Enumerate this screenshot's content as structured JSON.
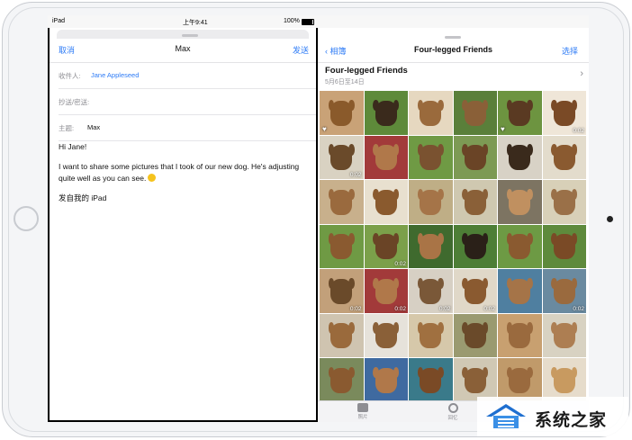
{
  "status_bar": {
    "device": "iPad",
    "time": "上午9:41",
    "battery": "100%"
  },
  "mail": {
    "cancel": "取消",
    "title": "Max",
    "send": "发送",
    "to_label": "收件人:",
    "to_value": "Jane Appleseed",
    "cc_label": "抄送/密送:",
    "subject_label": "主题:",
    "subject_value": "Max",
    "greeting": "Hi Jane!",
    "body": "I want to share some pictures that I took of our new dog. He's adjusting quite well as you can see.",
    "signature": "发自我的 iPad"
  },
  "photos": {
    "back_label": "相簿",
    "nav_title": "Four-legged Friends",
    "select_label": "选择",
    "album_title": "Four-legged Friends",
    "album_date": "5月6日至14日",
    "thumbnails": [
      {
        "bg": "#c9a277",
        "dog": "#8a5a2b"
      },
      {
        "bg": "#5e8a3a",
        "dog": "#3a2a1c"
      },
      {
        "bg": "#e6d8c0",
        "dog": "#9a6a3c"
      },
      {
        "bg": "#5a7f3a",
        "dog": "#8a6038"
      },
      {
        "bg": "#6d9440",
        "dog": "#5a3a22"
      },
      {
        "bg": "#efe6d8",
        "dog": "#7a4a26",
        "duration": "0:02"
      },
      {
        "bg": "#d9d2c2",
        "dog": "#6a4a2a",
        "duration": "0:02"
      },
      {
        "bg": "#a23a3a",
        "dog": "#b0784a"
      },
      {
        "bg": "#6f9a44",
        "dog": "#7a5230"
      },
      {
        "bg": "#7d9a54",
        "dog": "#6a4426"
      },
      {
        "bg": "#d8d2c6",
        "dog": "#3a2a1c"
      },
      {
        "bg": "#e3dccc",
        "dog": "#8a5a30"
      },
      {
        "bg": "#c8b08c",
        "dog": "#9a6a3e"
      },
      {
        "bg": "#e8e0cf",
        "dog": "#8a5a2e"
      },
      {
        "bg": "#bfae86",
        "dog": "#a57448"
      },
      {
        "bg": "#cfc8b0",
        "dog": "#8a6038"
      },
      {
        "bg": "#7d7462",
        "dog": "#c09060"
      },
      {
        "bg": "#d8d0b8",
        "dog": "#9a7048"
      },
      {
        "bg": "#6f9a44",
        "dog": "#8a5a30"
      },
      {
        "bg": "#7ba04a",
        "dog": "#6a4426",
        "duration": "0:02"
      },
      {
        "bg": "#3f6a2e",
        "dog": "#a97446"
      },
      {
        "bg": "#4d7e36",
        "dog": "#2a2018"
      },
      {
        "bg": "#6d9a44",
        "dog": "#8a5a30"
      },
      {
        "bg": "#5e8a3c",
        "dog": "#7a4a26"
      },
      {
        "bg": "#c2a07a",
        "dog": "#6a4a2a",
        "duration": "0:02"
      },
      {
        "bg": "#a23a3a",
        "dog": "#b0784a",
        "duration": "0:02"
      },
      {
        "bg": "#d7d0c4",
        "dog": "#7a5838",
        "duration": "0:02"
      },
      {
        "bg": "#e0d8c8",
        "dog": "#8a5a30",
        "duration": "0:02"
      },
      {
        "bg": "#4f7fa0",
        "dog": "#a57448"
      },
      {
        "bg": "#6a8aa0",
        "dog": "#9a6a3e",
        "duration": "0:02"
      },
      {
        "bg": "#cfc4b0",
        "dog": "#9a6a3c"
      },
      {
        "bg": "#e6e2da",
        "dog": "#8a6038"
      },
      {
        "bg": "#d6c8aa",
        "dog": "#a07040"
      },
      {
        "bg": "#9a9a70",
        "dog": "#6a4a2a"
      },
      {
        "bg": "#c8a070",
        "dog": "#9a6a3e"
      },
      {
        "bg": "#d8d2c2",
        "dog": "#ad7e52"
      },
      {
        "bg": "#7a8a5c",
        "dog": "#8a5a30"
      },
      {
        "bg": "#3f6aa0",
        "dog": "#b0784a"
      },
      {
        "bg": "#3a7a8a",
        "dog": "#7a4a26"
      },
      {
        "bg": "#d0c8b4",
        "dog": "#8a6038"
      },
      {
        "bg": "#c09a6a",
        "dog": "#9a6a3e"
      },
      {
        "bg": "#e6dccb",
        "dog": "#c89a60"
      },
      {
        "bg": "#d06a3a",
        "dog": "#8a5a30"
      },
      {
        "bg": "#c8c0b0",
        "dog": "#7a4a26"
      },
      {
        "bg": "#b8a888",
        "dog": "#8a6038"
      },
      {
        "bg": "#6a8a4a",
        "dog": "#3a2a1c"
      },
      {
        "bg": "#8a6a40",
        "dog": "#c09060"
      },
      {
        "bg": "#c8a070",
        "dog": "#9a6a3e"
      }
    ],
    "tabs": [
      {
        "label": "照片"
      },
      {
        "label": "回忆"
      }
    ]
  },
  "watermark": {
    "text": "系统之家"
  }
}
